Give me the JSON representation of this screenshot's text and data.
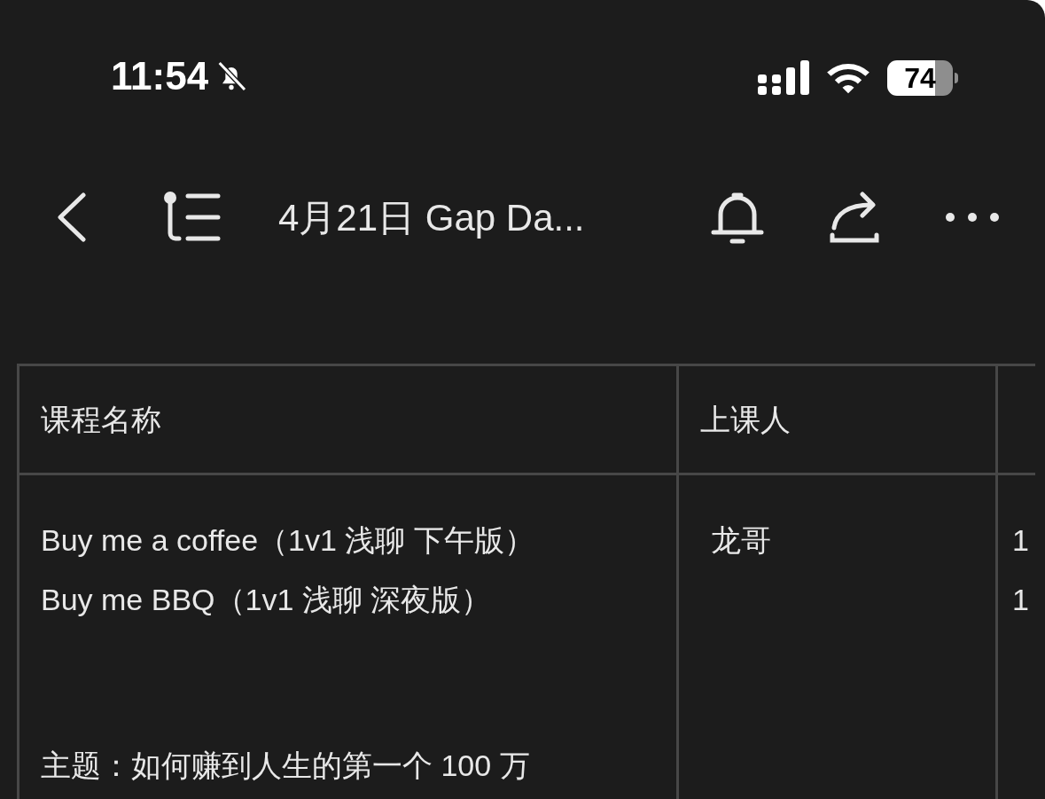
{
  "status_bar": {
    "time": "11:54",
    "silent": true,
    "battery": "74"
  },
  "nav_bar": {
    "title": "4月21日 Gap Da..."
  },
  "table": {
    "columns": [
      {
        "label": "课程名称"
      },
      {
        "label": "上课人"
      }
    ],
    "rows": [
      {
        "cells": [
          {
            "paragraphs": [
              "Buy me a coffee（1v1 浅聊 下午版）",
              "Buy me BBQ（1v1 浅聊 深夜版）",
              "主题：如何赚到人生的第一个 100 万"
            ]
          },
          {
            "paragraphs": [
              "龙哥"
            ]
          },
          {
            "paragraphs": [
              "1",
              "1"
            ]
          }
        ]
      }
    ]
  }
}
